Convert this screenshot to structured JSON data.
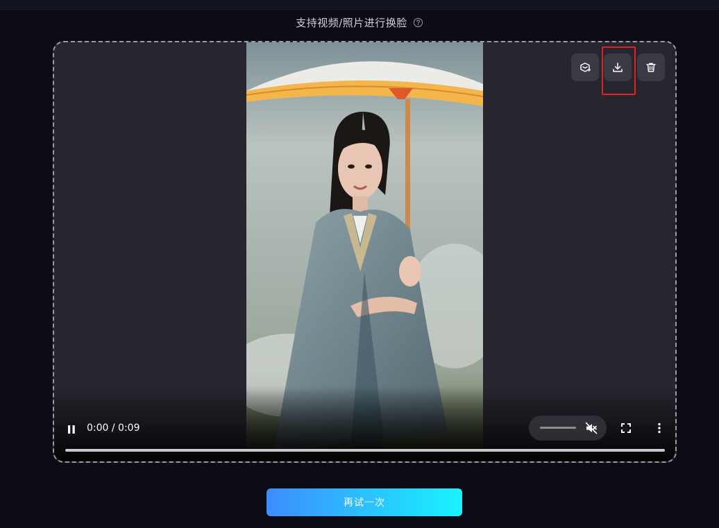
{
  "header": {
    "title": "支持视频/照片进行换脸",
    "help_icon": "question-circle-icon"
  },
  "actions": {
    "buttons": [
      {
        "id": "swap",
        "icon": "face-swap-icon"
      },
      {
        "id": "download",
        "icon": "download-icon",
        "highlighted": true
      },
      {
        "id": "delete",
        "icon": "trash-icon"
      }
    ],
    "highlight_color": "#e3221c"
  },
  "player": {
    "state": "playing",
    "time": "0:00 / 0:09",
    "progress": 0.0,
    "muted": true,
    "icons": [
      "pause-icon",
      "volume-muted-icon",
      "fullscreen-icon",
      "more-vertical-icon"
    ]
  },
  "footer": {
    "retry_label": "再试一次",
    "gradient": [
      "#3d8dfd",
      "#19f3ff"
    ]
  }
}
